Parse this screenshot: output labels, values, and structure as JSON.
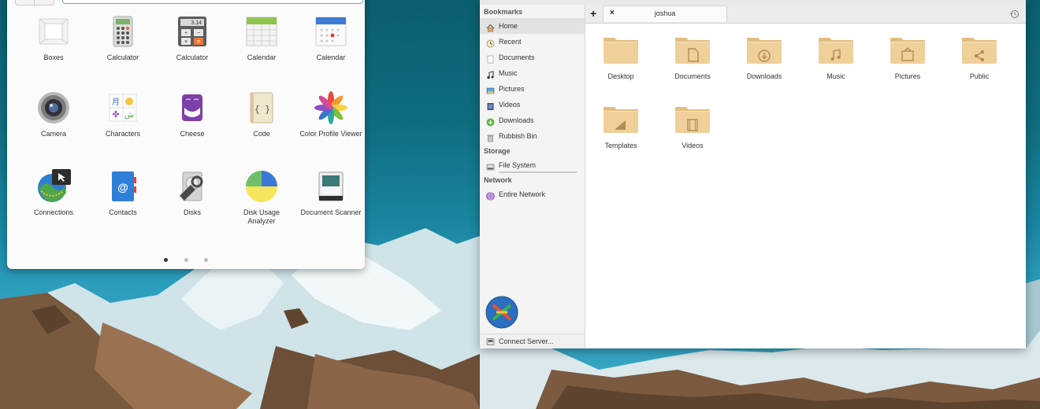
{
  "launcher": {
    "apps": [
      {
        "label": "Boxes",
        "icon": "boxes-icon"
      },
      {
        "label": "Calculator",
        "icon": "calculator-icon"
      },
      {
        "label": "Calculator",
        "icon": "calculator-alt-icon",
        "display": "3.14"
      },
      {
        "label": "Calendar",
        "icon": "calendar-icon"
      },
      {
        "label": "Calendar",
        "icon": "calendar-alt-icon"
      },
      {
        "label": "Camera",
        "icon": "camera-icon"
      },
      {
        "label": "Characters",
        "icon": "characters-icon"
      },
      {
        "label": "Cheese",
        "icon": "cheese-icon"
      },
      {
        "label": "Code",
        "icon": "code-icon",
        "glyph": "{ }"
      },
      {
        "label": "Color Profile Viewer",
        "icon": "color-profile-icon"
      },
      {
        "label": "Connections",
        "icon": "connections-icon"
      },
      {
        "label": "Contacts",
        "icon": "contacts-icon",
        "glyph": "@"
      },
      {
        "label": "Disks",
        "icon": "disks-icon"
      },
      {
        "label": "Disk Usage\nAnalyzer",
        "icon": "disk-usage-icon"
      },
      {
        "label": "Document Scanner",
        "icon": "document-scanner-icon"
      }
    ],
    "pages": 3,
    "active_page": 0
  },
  "files": {
    "sidebar": {
      "bookmarks_header": "Bookmarks",
      "bookmarks": [
        {
          "label": "Home",
          "icon": "home-icon",
          "selected": true
        },
        {
          "label": "Recent",
          "icon": "recent-icon"
        },
        {
          "label": "Documents",
          "icon": "documents-icon"
        },
        {
          "label": "Music",
          "icon": "music-icon"
        },
        {
          "label": "Pictures",
          "icon": "pictures-icon"
        },
        {
          "label": "Videos",
          "icon": "videos-icon"
        },
        {
          "label": "Downloads",
          "icon": "downloads-icon"
        },
        {
          "label": "Rubbish Bin",
          "icon": "rubbish-bin-icon"
        }
      ],
      "storage_header": "Storage",
      "storage": [
        {
          "label": "File System",
          "icon": "drive-icon"
        }
      ],
      "network_header": "Network",
      "network": [
        {
          "label": "Entire Network",
          "icon": "network-icon"
        }
      ],
      "connect_server": "Connect Server..."
    },
    "tab": {
      "add": "+",
      "close": "×",
      "title": "joshua"
    },
    "folders": [
      {
        "label": "Desktop",
        "emblem": "none"
      },
      {
        "label": "Documents",
        "emblem": "document"
      },
      {
        "label": "Downloads",
        "emblem": "download"
      },
      {
        "label": "Music",
        "emblem": "music"
      },
      {
        "label": "Pictures",
        "emblem": "picture"
      },
      {
        "label": "Public",
        "emblem": "share"
      },
      {
        "label": "Templates",
        "emblem": "template"
      },
      {
        "label": "Videos",
        "emblem": "video"
      }
    ],
    "colors": {
      "folder_body": "#efcf9a",
      "folder_tab": "#e3bd80",
      "emblem": "#b58b52"
    }
  }
}
